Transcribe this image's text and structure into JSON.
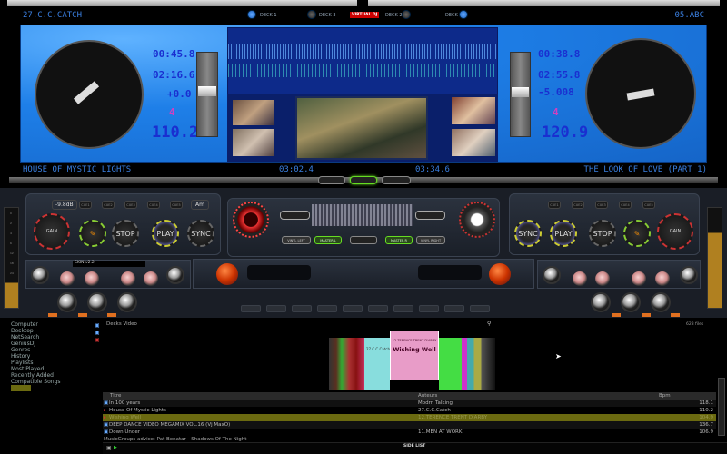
{
  "header": {
    "left_title": "27.C.C.CATCH",
    "right_title": "05.ABC",
    "logo": "VIRTUAL DJ",
    "decks": [
      "DECK 1",
      "DECK 3",
      "DECK 2",
      "DECK 4"
    ]
  },
  "deck_left": {
    "elapsed": "00:45.8",
    "remaining": "02:16.6",
    "pitch": "+0.0",
    "key": "4",
    "bpm": "110.2",
    "title": "HOUSE OF MYSTIC LIGHTS",
    "time": "03:02.4",
    "gain_db": "-9.8dB",
    "key_label": "Am",
    "cues": [
      "CUE1",
      "CUE2",
      "CUE3",
      "CUE4",
      "CUE5"
    ],
    "buttons": {
      "gain": "GAIN",
      "stop": "STOP",
      "play": "PLAY",
      "sync": "SYNC"
    },
    "effect": "SKIN v2.2"
  },
  "deck_right": {
    "elapsed": "00:38.8",
    "remaining": "02:55.8",
    "pitch": "-5.008",
    "key": "4",
    "bpm": "120.9",
    "title": "THE LOOK OF LOVE (PART 1)",
    "time": "03:34.6",
    "cues": [
      "CUE1",
      "CUE2",
      "CUE3",
      "CUE4",
      "CUE5"
    ],
    "buttons": {
      "gain": "GAIN",
      "stop": "STOP",
      "play": "PLAY",
      "sync": "SYNC"
    }
  },
  "mixer": {
    "vinyl_left": "VINYL LEFT",
    "master1": "MASTER L",
    "master2": "MASTER R",
    "vinyl_right": "VINYL RIGHT"
  },
  "vu_scale": [
    "0",
    "2",
    "4",
    "6",
    "12",
    "18",
    "24"
  ],
  "browser": {
    "tree": [
      "Computer",
      "Desktop",
      "NetSearch",
      "GeniusDJ",
      "Genres",
      "History",
      "Playlists",
      "Most Played",
      "Recently Added",
      "Compatible Songs",
      "Sidelist"
    ],
    "path": "Decks  Video",
    "file_count": "628 files",
    "cover": {
      "artist": "12.TERENCE TRENT D'ARBY",
      "title": "Wishing Well",
      "left_artist": "27.C.C.Catch"
    },
    "columns": [
      "Titre",
      "Auteurs",
      "Bpm"
    ],
    "rows": [
      {
        "title": "In 100 years",
        "artist": "Modrn Talking",
        "bpm": "118.1"
      },
      {
        "title": "House Of Mystic Lights",
        "artist": "27.C.C.Catch",
        "bpm": "110.2"
      },
      {
        "title": "Wishing Well",
        "artist": "12.TERENCE TRENT D'ARBY",
        "bpm": "104.9"
      },
      {
        "title": "DEEP DANCE VIDEO MEGAMIX VOL.16 (Vj MaxO)",
        "artist": "",
        "bpm": "136.7"
      },
      {
        "title": "Down Under",
        "artist": "11.MEN AT WORK",
        "bpm": "106.9"
      }
    ],
    "advice": "MusicGroups advice: Pat Benatar - Shadows Of The Night",
    "side_list": "SIDE LIST"
  },
  "colors": {
    "accent": "#1e7fe8",
    "lcd": "#1a2fd0",
    "highlight": "#6b6a10"
  }
}
